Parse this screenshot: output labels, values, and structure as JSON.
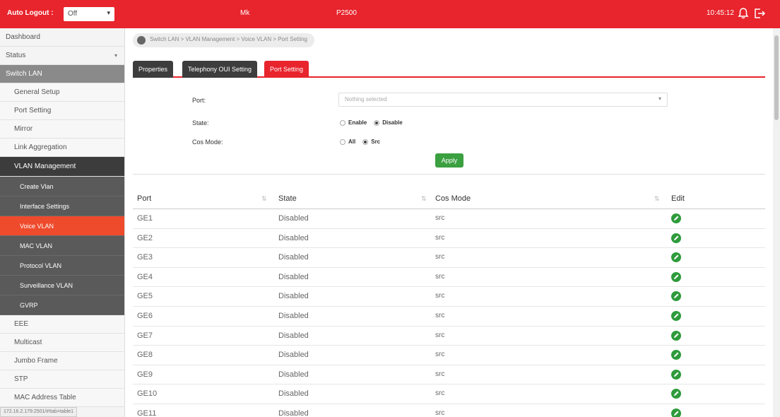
{
  "topbar": {
    "auto_logout_label": "Auto Logout :",
    "auto_logout_value": "Off",
    "model": "Mk",
    "product": "P2500",
    "time": "10:45:12",
    "accent_color": "#e8242c"
  },
  "sidebar": {
    "items": [
      {
        "label": "Dashboard"
      },
      {
        "label": "Status"
      },
      {
        "label": "Switch LAN"
      },
      {
        "label": "General Setup"
      },
      {
        "label": "Port Setting"
      },
      {
        "label": "Mirror"
      },
      {
        "label": "Link Aggregation"
      },
      {
        "label": "VLAN Management"
      },
      {
        "label": "Create Vlan"
      },
      {
        "label": "Interface Settings"
      },
      {
        "label": "Voice VLAN"
      },
      {
        "label": "MAC VLAN"
      },
      {
        "label": "Protocol VLAN"
      },
      {
        "label": "Surveillance VLAN"
      },
      {
        "label": "GVRP"
      },
      {
        "label": "EEE"
      },
      {
        "label": "Multicast"
      },
      {
        "label": "Jumbo Frame"
      },
      {
        "label": "STP"
      },
      {
        "label": "MAC Address Table"
      }
    ],
    "status_url": "172.16.2.179:2501/#!tab=table1"
  },
  "breadcrumb": "Switch LAN > VLAN Management > Voice VLAN > Port Setting",
  "tabs": [
    {
      "label": "Properties"
    },
    {
      "label": "Telephony OUI Setting"
    },
    {
      "label": "Port Setting"
    }
  ],
  "form": {
    "port_label": "Port:",
    "port_placeholder": "Nothing selected",
    "state_label": "State:",
    "state_options": [
      "Enable",
      "Disable"
    ],
    "state_selected": "Disable",
    "cos_label": "Cos Mode:",
    "cos_options": [
      "All",
      "Src"
    ],
    "cos_selected": "Src",
    "apply_label": "Apply"
  },
  "table": {
    "headers": [
      "Port",
      "State",
      "Cos Mode",
      "Edit"
    ],
    "rows": [
      {
        "port": "GE1",
        "state": "Disabled",
        "cos": "src"
      },
      {
        "port": "GE2",
        "state": "Disabled",
        "cos": "src"
      },
      {
        "port": "GE3",
        "state": "Disabled",
        "cos": "src"
      },
      {
        "port": "GE4",
        "state": "Disabled",
        "cos": "src"
      },
      {
        "port": "GE5",
        "state": "Disabled",
        "cos": "src"
      },
      {
        "port": "GE6",
        "state": "Disabled",
        "cos": "src"
      },
      {
        "port": "GE7",
        "state": "Disabled",
        "cos": "src"
      },
      {
        "port": "GE8",
        "state": "Disabled",
        "cos": "src"
      },
      {
        "port": "GE9",
        "state": "Disabled",
        "cos": "src"
      },
      {
        "port": "GE10",
        "state": "Disabled",
        "cos": "src"
      },
      {
        "port": "GE11",
        "state": "Disabled",
        "cos": "src"
      }
    ]
  }
}
